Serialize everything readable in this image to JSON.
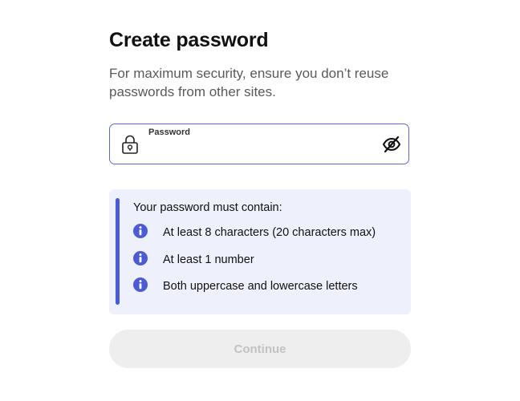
{
  "header": {
    "title": "Create password",
    "subtitle": "For maximum security, ensure you don’t reuse passwords from other sites."
  },
  "password_field": {
    "label": "Password",
    "value": "",
    "placeholder": "",
    "leading_icon": "lock-icon",
    "toggle_icon": "eye-slash-icon"
  },
  "requirements": {
    "heading": "Your password must contain:",
    "items": [
      {
        "icon": "info-icon",
        "label": "At least 8 characters (20 characters max)"
      },
      {
        "icon": "info-icon",
        "label": "At least 1 number"
      },
      {
        "icon": "info-icon",
        "label": "Both uppercase and lowercase letters"
      }
    ]
  },
  "actions": {
    "continue_label": "Continue",
    "continue_disabled": true
  },
  "colors": {
    "accent": "#4c5bd4",
    "field_border": "#5a67d8",
    "panel_background": "#eef1fc",
    "button_disabled_bg": "#eeeeee",
    "button_disabled_text": "#c2c2c2"
  }
}
